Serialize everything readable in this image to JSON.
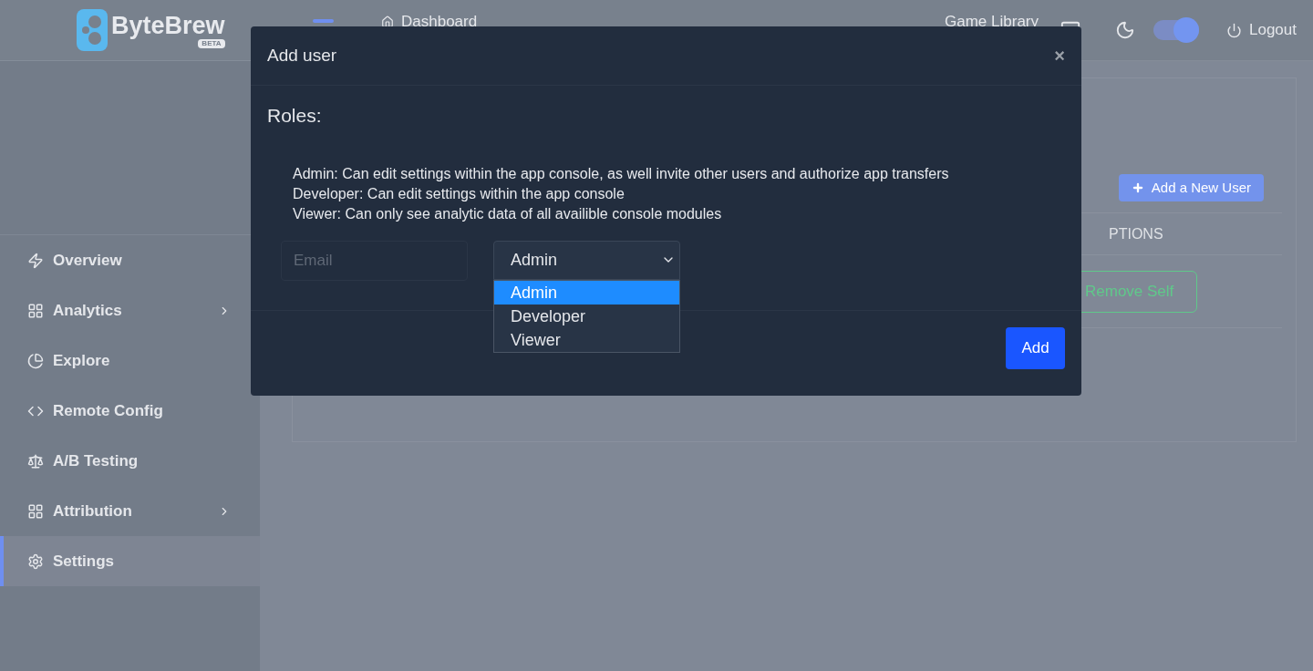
{
  "brand": {
    "name": "ByteBrew",
    "badge": "BETA"
  },
  "navbar": {
    "links": [
      {
        "label": "Dashboard"
      },
      {
        "label": "Game Library"
      }
    ],
    "dark_mode": {
      "on": true
    },
    "logout": "Logout"
  },
  "sidebar": {
    "items": [
      {
        "label": "Overview",
        "kind": "bolt",
        "expandable": false,
        "selected": false
      },
      {
        "label": "Analytics",
        "kind": "grid",
        "expandable": true,
        "selected": false
      },
      {
        "label": "Explore",
        "kind": "pie",
        "expandable": false,
        "selected": false
      },
      {
        "label": "Remote Config",
        "kind": "code",
        "expandable": false,
        "selected": false
      },
      {
        "label": "A/B Testing",
        "kind": "scale",
        "expandable": false,
        "selected": false
      },
      {
        "label": "Attribution",
        "kind": "grid",
        "expandable": true,
        "selected": false
      },
      {
        "label": "Settings",
        "kind": "gear",
        "expandable": false,
        "selected": true
      }
    ]
  },
  "page": {
    "add_button": "Add a New User",
    "table": {
      "column_heading": "PTIONS",
      "row_action": "Remove Self"
    }
  },
  "modal": {
    "title": "Add user",
    "close": "×",
    "roles_heading": "Roles:",
    "role_descriptions": [
      "Admin: Can edit settings within the app console, as well invite other users and authorize app transfers",
      "Developer: Can edit settings within the app console",
      "Viewer: Can only see analytic data of all availible console modules"
    ],
    "email": {
      "placeholder": "Email"
    },
    "role_select": {
      "value": "Admin",
      "options": [
        {
          "label": "Admin",
          "selected": true
        },
        {
          "label": "Developer",
          "selected": false
        },
        {
          "label": "Viewer",
          "selected": false
        }
      ]
    },
    "submit": "Add"
  }
}
